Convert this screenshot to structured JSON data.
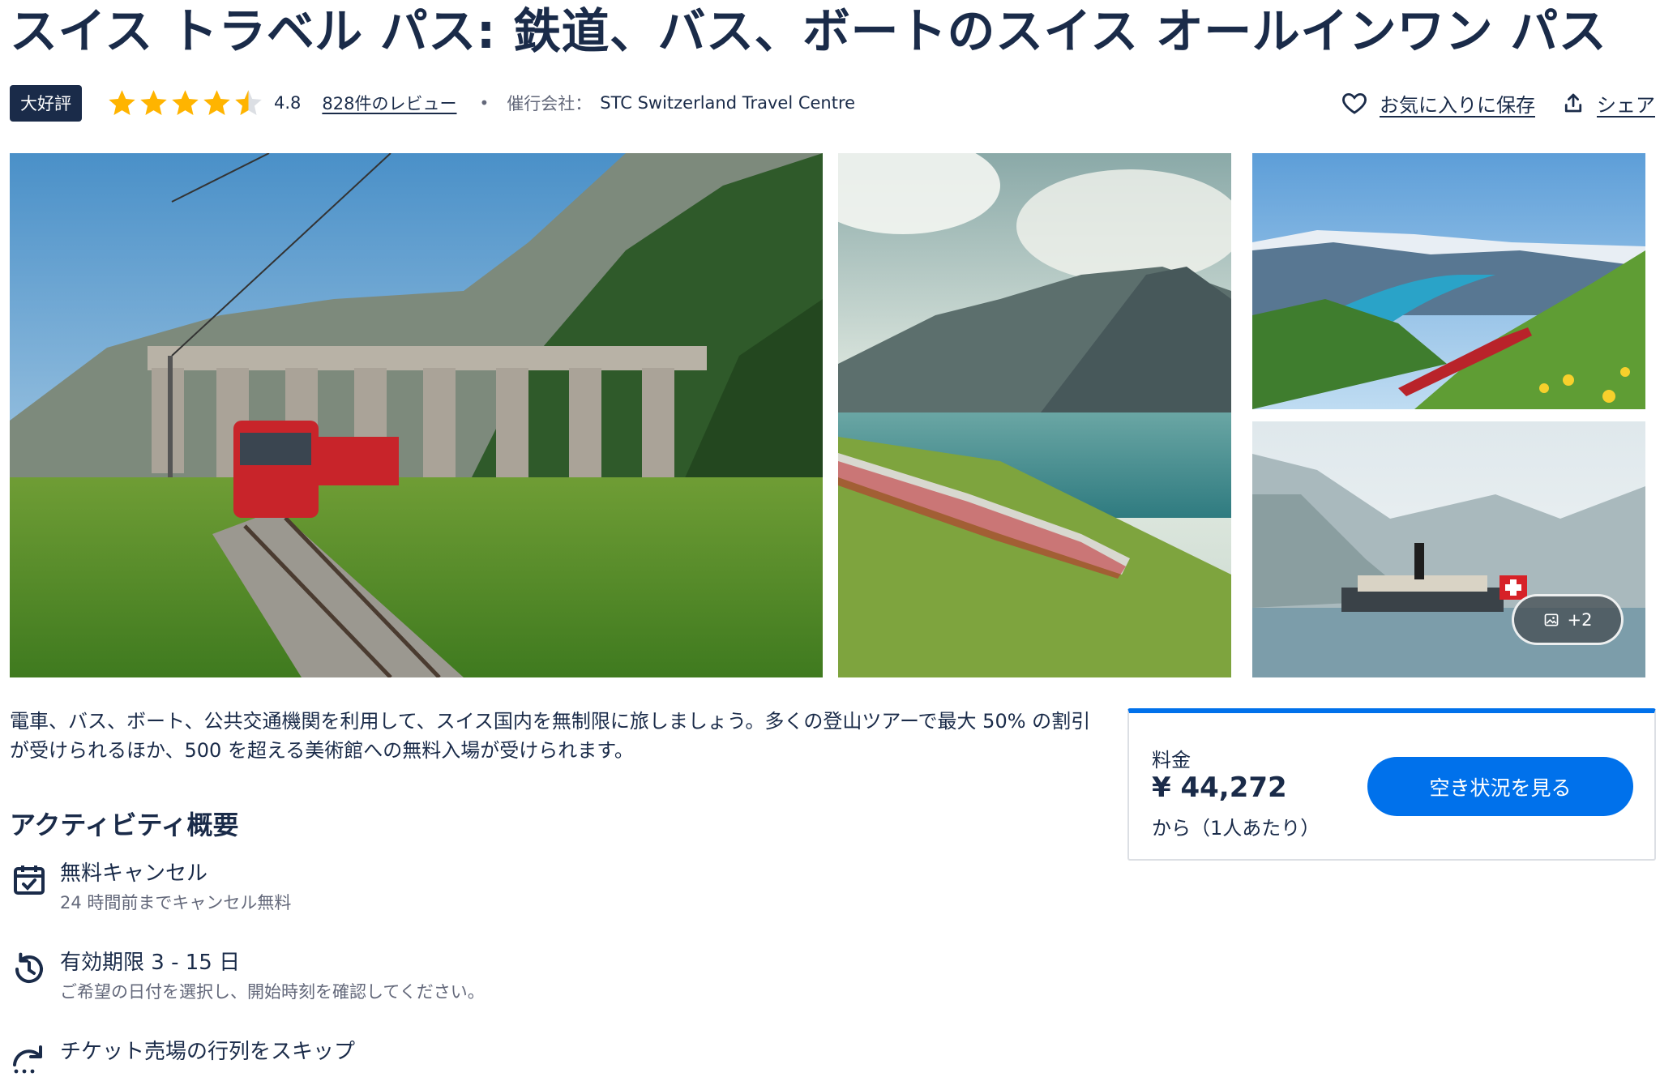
{
  "header": {
    "title": "スイス トラベル パス: 鉄道、バス、ボートのスイス オールインワン パス",
    "badge": "大好評",
    "rating_value": 4.8,
    "rating": "4.8",
    "reviews": "828件のレビュー",
    "separator": "•",
    "operator_label": "催行会社：",
    "operator_name": "STC Switzerland Travel Centre",
    "save_label": "お気に入りに保存",
    "share_label": "シェア"
  },
  "gallery": {
    "more_count": "+2"
  },
  "description": "電車、バス、ボート、公共交通機関を利用して、スイス国内を無制限に旅しましょう。多くの登山ツアーで最大 50% の割引が受けられるほか、500 を超える美術館への無料入場が受けられます。",
  "overview": {
    "heading": "アクティビティ概要",
    "features": [
      {
        "title": "無料キャンセル",
        "subtitle": "24 時間前までキャンセル無料",
        "icon": "calendar-check-icon"
      },
      {
        "title": "有効期限 3 - 15 日",
        "subtitle": "ご希望の日付を選択し、開始時刻を確認してください。",
        "icon": "clock-history-icon"
      },
      {
        "title": "チケット売場の行列をスキップ",
        "subtitle": "",
        "icon": "skip-line-icon"
      }
    ]
  },
  "price_card": {
    "label": "料金",
    "price": "¥ 44,272",
    "per": "から（1人あたり）",
    "button": "空き状況を見る"
  },
  "colors": {
    "primary_text": "#1a2b49",
    "accent_blue": "#0071eb",
    "star": "#ffb400",
    "muted": "#63687a"
  }
}
